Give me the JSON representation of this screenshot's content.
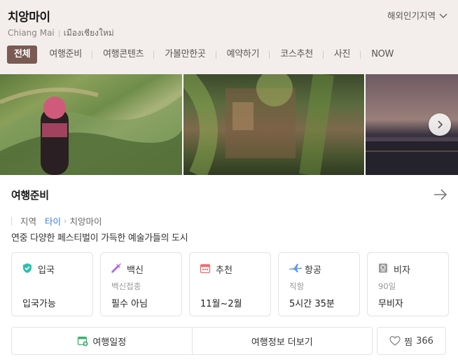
{
  "header": {
    "title": "치앙마이",
    "subtitle_en": "Chiang Mai",
    "subtitle_local": "เมืองเชียงใหม่",
    "region_link": "해외인기지역"
  },
  "tabs": [
    {
      "label": "전체",
      "active": true
    },
    {
      "label": "여행준비"
    },
    {
      "label": "여행콘텐츠"
    },
    {
      "label": "가볼만한곳"
    },
    {
      "label": "예약하기"
    },
    {
      "label": "코스추천"
    },
    {
      "label": "사진"
    },
    {
      "label": "NOW"
    }
  ],
  "section": {
    "title": "여행준비",
    "breadcrumb": {
      "label": "지역",
      "country": "타이",
      "city": "치앙마이"
    },
    "description": "연중 다양한 페스티벌이 가득한 예술가들의 도시"
  },
  "cards": [
    {
      "icon": "shield-check-icon",
      "label": "입국",
      "sub": "",
      "value": "입국가능"
    },
    {
      "icon": "syringe-icon",
      "label": "백신",
      "sub": "백신접종",
      "value": "필수 아님"
    },
    {
      "icon": "calendar-icon",
      "label": "추천",
      "sub": "",
      "value": "11월~2월"
    },
    {
      "icon": "airplane-icon",
      "label": "항공",
      "sub": "직항",
      "value": "5시간 35분"
    },
    {
      "icon": "passport-icon",
      "label": "비자",
      "sub": "90일",
      "value": "무비자"
    }
  ],
  "actions": {
    "itinerary": "여행일정",
    "more_info": "여행정보 더보기",
    "like_label": "찜",
    "like_count": "366"
  },
  "colors": {
    "header_bg": "#f3eeec",
    "active_tab": "#7a5a52",
    "link_blue": "#3a7bd5"
  }
}
